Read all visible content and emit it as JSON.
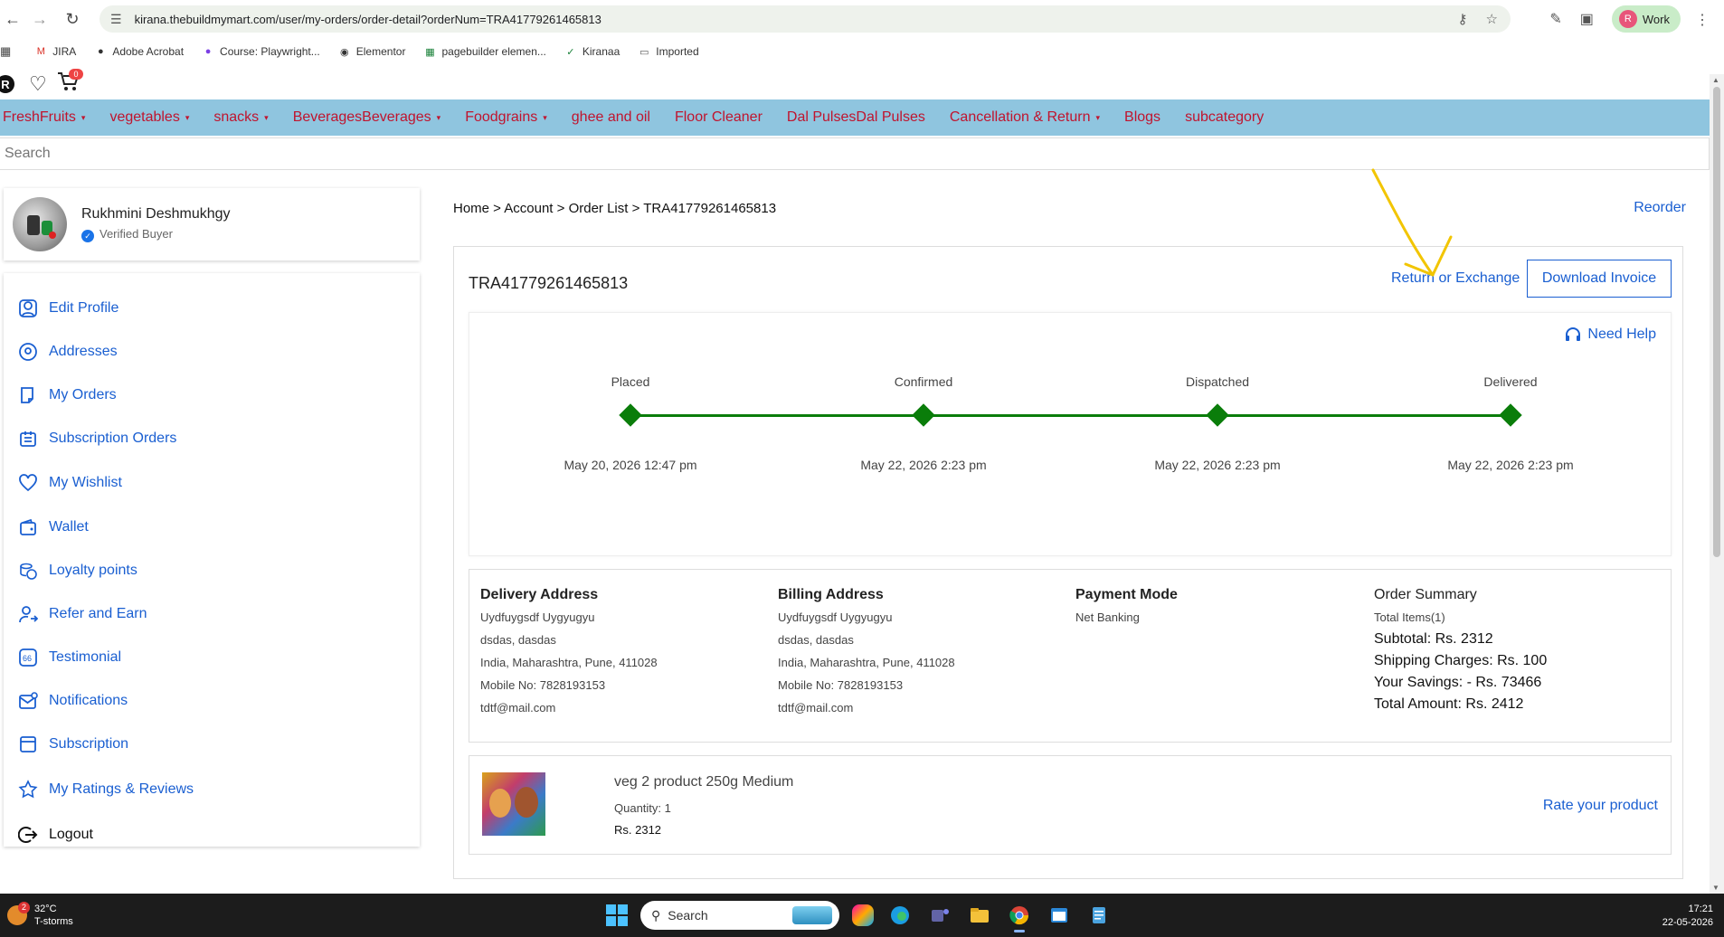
{
  "browser": {
    "url": "kirana.thebuildmymart.com/user/my-orders/order-detail?orderNum=TRA41779261465813",
    "profile_label": "Work",
    "profile_initial": "R"
  },
  "bookmarks": [
    {
      "label": "JIRA",
      "icon": "gmail-icon",
      "color": "#d93025"
    },
    {
      "label": "Adobe Acrobat",
      "icon": "acrobat-icon",
      "color": "#333333"
    },
    {
      "label": "Course: Playwright...",
      "icon": "course-icon",
      "color": "#7b3fe4"
    },
    {
      "label": "Elementor",
      "icon": "elementor-icon",
      "color": "#333333"
    },
    {
      "label": "pagebuilder elemen...",
      "icon": "sheets-icon",
      "color": "#188038"
    },
    {
      "label": "Kiranaa",
      "icon": "kiranaa-icon",
      "color": "#188038"
    },
    {
      "label": "Imported",
      "icon": "folder-icon",
      "color": "#555555"
    }
  ],
  "site": {
    "logo_letter": "R",
    "cart_count": "0",
    "categories": [
      {
        "label": "FreshFruits",
        "dropdown": true
      },
      {
        "label": "vegetables",
        "dropdown": true
      },
      {
        "label": "snacks",
        "dropdown": true
      },
      {
        "label": "BeveragesBeverages",
        "dropdown": true
      },
      {
        "label": "Foodgrains",
        "dropdown": true
      },
      {
        "label": "ghee and oil",
        "dropdown": false
      },
      {
        "label": "Floor Cleaner",
        "dropdown": false
      },
      {
        "label": "Dal PulsesDal Pulses",
        "dropdown": false
      },
      {
        "label": "Cancellation & Return",
        "dropdown": true
      },
      {
        "label": "Blogs",
        "dropdown": false
      },
      {
        "label": "subcategory",
        "dropdown": false
      }
    ],
    "search_placeholder": "Search"
  },
  "profile": {
    "name": "Rukhmini Deshmukhgy",
    "badge": "Verified Buyer"
  },
  "menu": [
    {
      "label": "Edit Profile",
      "icon": "user-icon"
    },
    {
      "label": "Addresses",
      "icon": "location-pin-icon"
    },
    {
      "label": "My Orders",
      "icon": "orders-icon"
    },
    {
      "label": "Subscription Orders",
      "icon": "subscription-orders-icon"
    },
    {
      "label": "My Wishlist",
      "icon": "heart-icon"
    },
    {
      "label": "Wallet",
      "icon": "wallet-icon"
    },
    {
      "label": "Loyalty points",
      "icon": "coins-icon"
    },
    {
      "label": "Refer and Earn",
      "icon": "refer-icon"
    },
    {
      "label": "Testimonial",
      "icon": "quote-icon"
    },
    {
      "label": "Notifications",
      "icon": "mail-icon"
    },
    {
      "label": "Subscription",
      "icon": "subscription-icon"
    },
    {
      "label": "My Ratings & Reviews",
      "icon": "star-icon"
    },
    {
      "label": "Logout",
      "icon": "logout-icon"
    }
  ],
  "breadcrumb": "Home > Account > Order List > TRA41779261465813",
  "reorder_label": "Reorder",
  "order": {
    "number": "TRA41779261465813",
    "return_label": "Return or Exchange",
    "invoice_label": "Download Invoice",
    "need_help": "Need Help",
    "stages": [
      {
        "label": "Placed",
        "date": "May 20, 2026 12:47 pm"
      },
      {
        "label": "Confirmed",
        "date": "May 22, 2026 2:23 pm"
      },
      {
        "label": "Dispatched",
        "date": "May 22, 2026 2:23 pm"
      },
      {
        "label": "Delivered",
        "date": "May 22, 2026 2:23 pm"
      }
    ],
    "delivery": {
      "title": "Delivery Address",
      "name": "Uydfuygsdf Uygyugyu",
      "line1": "dsdas, dasdas",
      "line2": "India, Maharashtra, Pune, 411028",
      "mobile": "Mobile No: 7828193153",
      "email": "tdtf@mail.com"
    },
    "billing": {
      "title": "Billing Address",
      "name": "Uydfuygsdf Uygyugyu",
      "line1": "dsdas, dasdas",
      "line2": "India, Maharashtra, Pune, 411028",
      "mobile": "Mobile No: 7828193153",
      "email": "tdtf@mail.com"
    },
    "payment": {
      "title": "Payment Mode",
      "value": "Net Banking"
    },
    "summary": {
      "title": "Order Summary",
      "items": "Total Items(1)",
      "subtotal": "Subtotal: Rs. 2312",
      "shipping": "Shipping Charges: Rs. 100",
      "savings": "Your Savings: - Rs. 73466",
      "total": "Total Amount: Rs. 2412"
    },
    "product": {
      "name": "veg 2 product 250g Medium",
      "quantity": "Quantity: 1",
      "price": "Rs. 2312",
      "rate_label": "Rate your product"
    }
  },
  "taskbar": {
    "temp": "32°C",
    "weather": "T-storms",
    "weather_badge": "2",
    "search_label": "Search",
    "time": "17:21",
    "date": "22-05-2026"
  },
  "colors": {
    "accent_link": "#1a5fd1",
    "nav_bg": "#8fc5df",
    "nav_text": "#c0142e",
    "track_green": "#0a7d0a",
    "annotation": "#f2c500"
  }
}
